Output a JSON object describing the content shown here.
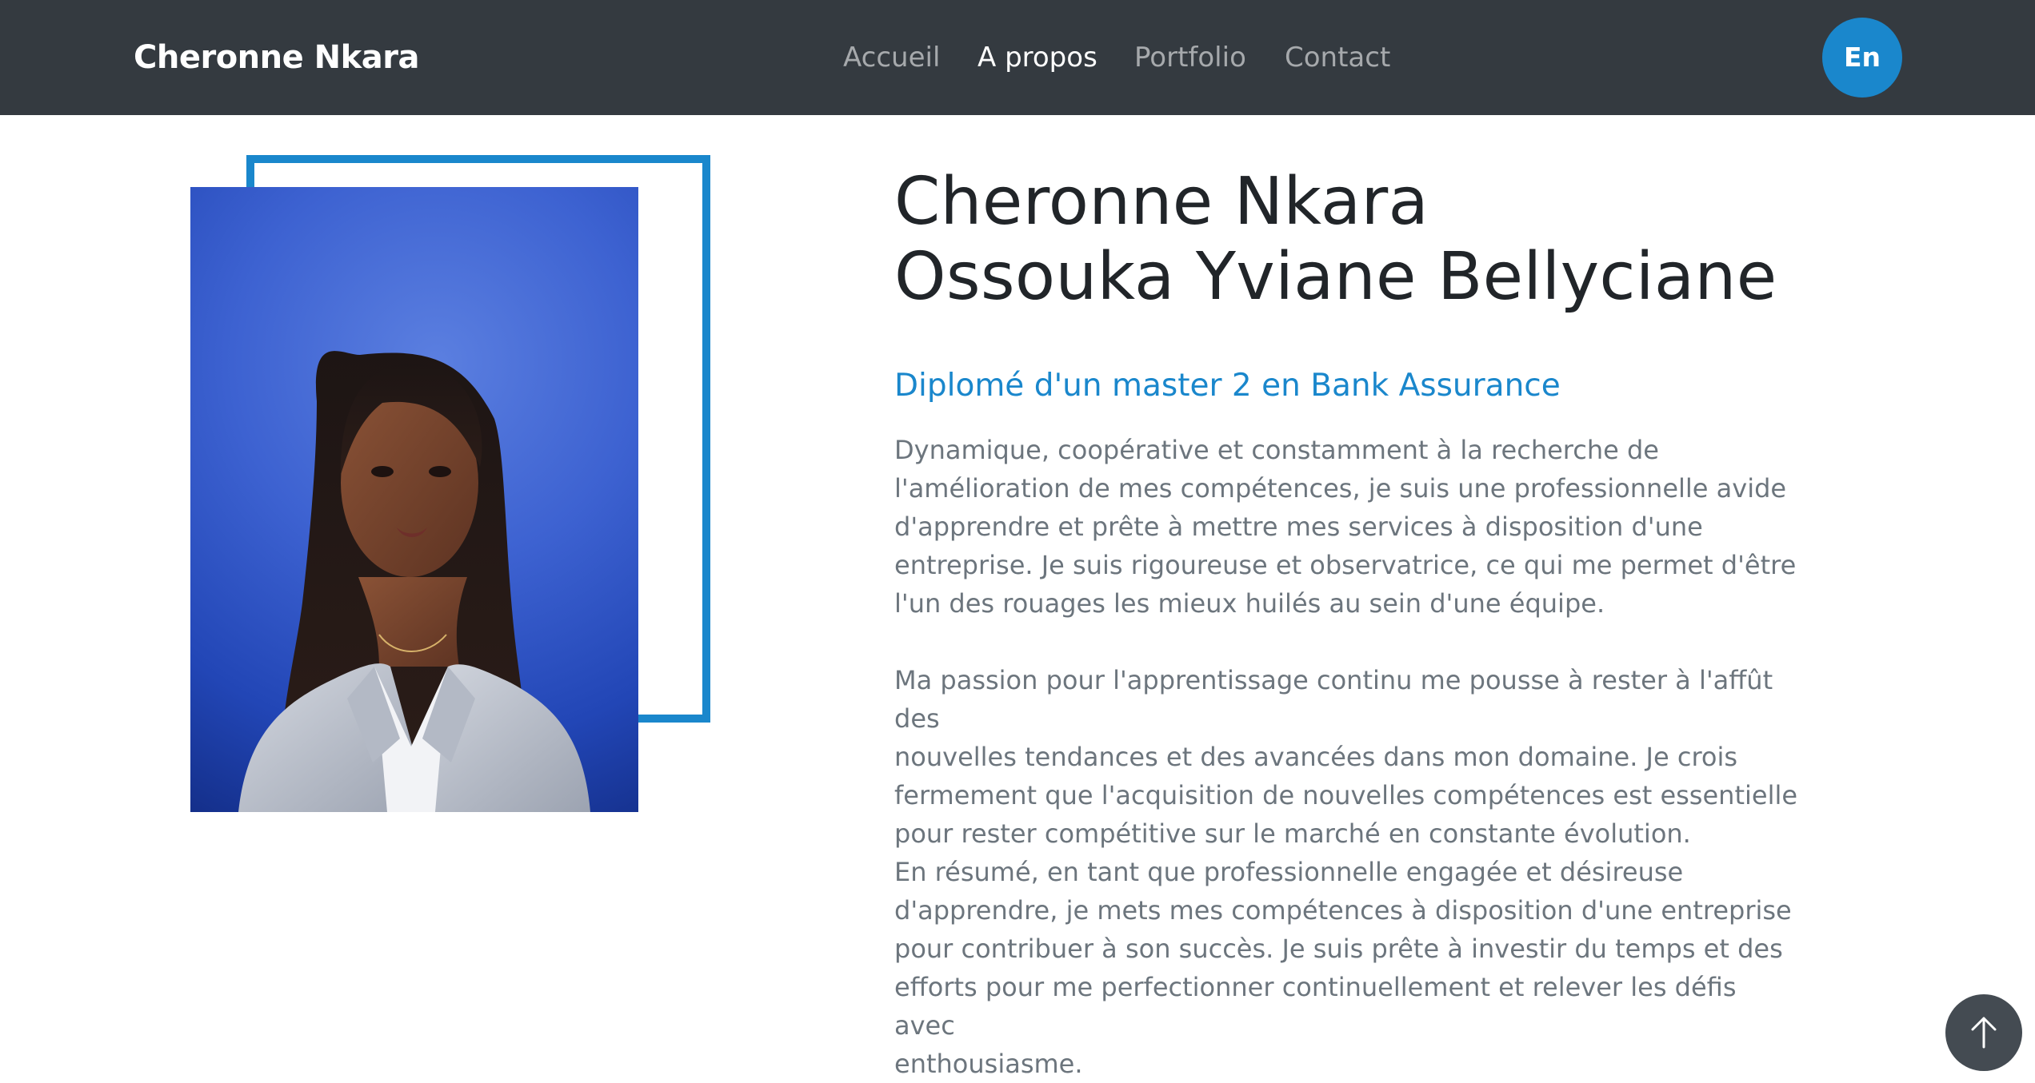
{
  "header": {
    "brand": "Cheronne Nkara",
    "nav": [
      {
        "label": "Accueil",
        "active": false
      },
      {
        "label": "A propos",
        "active": true
      },
      {
        "label": "Portfolio",
        "active": false
      },
      {
        "label": "Contact",
        "active": false
      }
    ],
    "language_button": "En"
  },
  "about": {
    "name_line1": "Cheronne Nkara",
    "name_line2": "Ossouka Yviane Bellyciane",
    "subtitle": "Diplomé d'un master 2 en Bank Assurance",
    "paragraphs": [
      [
        "Dynamique, coopérative et constamment à la recherche de",
        "l'amélioration de mes compétences, je suis une professionnelle avide",
        "d'apprendre et prête à mettre mes services à disposition d'une",
        "entreprise. Je suis rigoureuse et observatrice, ce qui me permet d'être",
        "l'un des rouages les mieux huilés au sein d'une équipe."
      ],
      [
        "Ma passion pour l'apprentissage continu me pousse à rester à l'affût des",
        "nouvelles tendances et des avancées dans mon domaine. Je crois",
        "fermement que l'acquisition de nouvelles compétences est essentielle",
        "pour rester compétitive sur le marché en constante évolution."
      ],
      [
        "En résumé, en tant que professionnelle engagée et désireuse",
        "d'apprendre, je mets mes compétences à disposition d'une entreprise",
        "pour contribuer à son succès. Je suis prête à investir du temps et des",
        "efforts pour me perfectionner continuellement et relever les défis avec",
        "enthousiasme."
      ]
    ]
  },
  "icons": {
    "scroll_top": "arrow-up-icon"
  },
  "colors": {
    "navbar": "#343a40",
    "accent": "#1a87cc",
    "heading": "#212529",
    "body_text": "#6c757d"
  }
}
